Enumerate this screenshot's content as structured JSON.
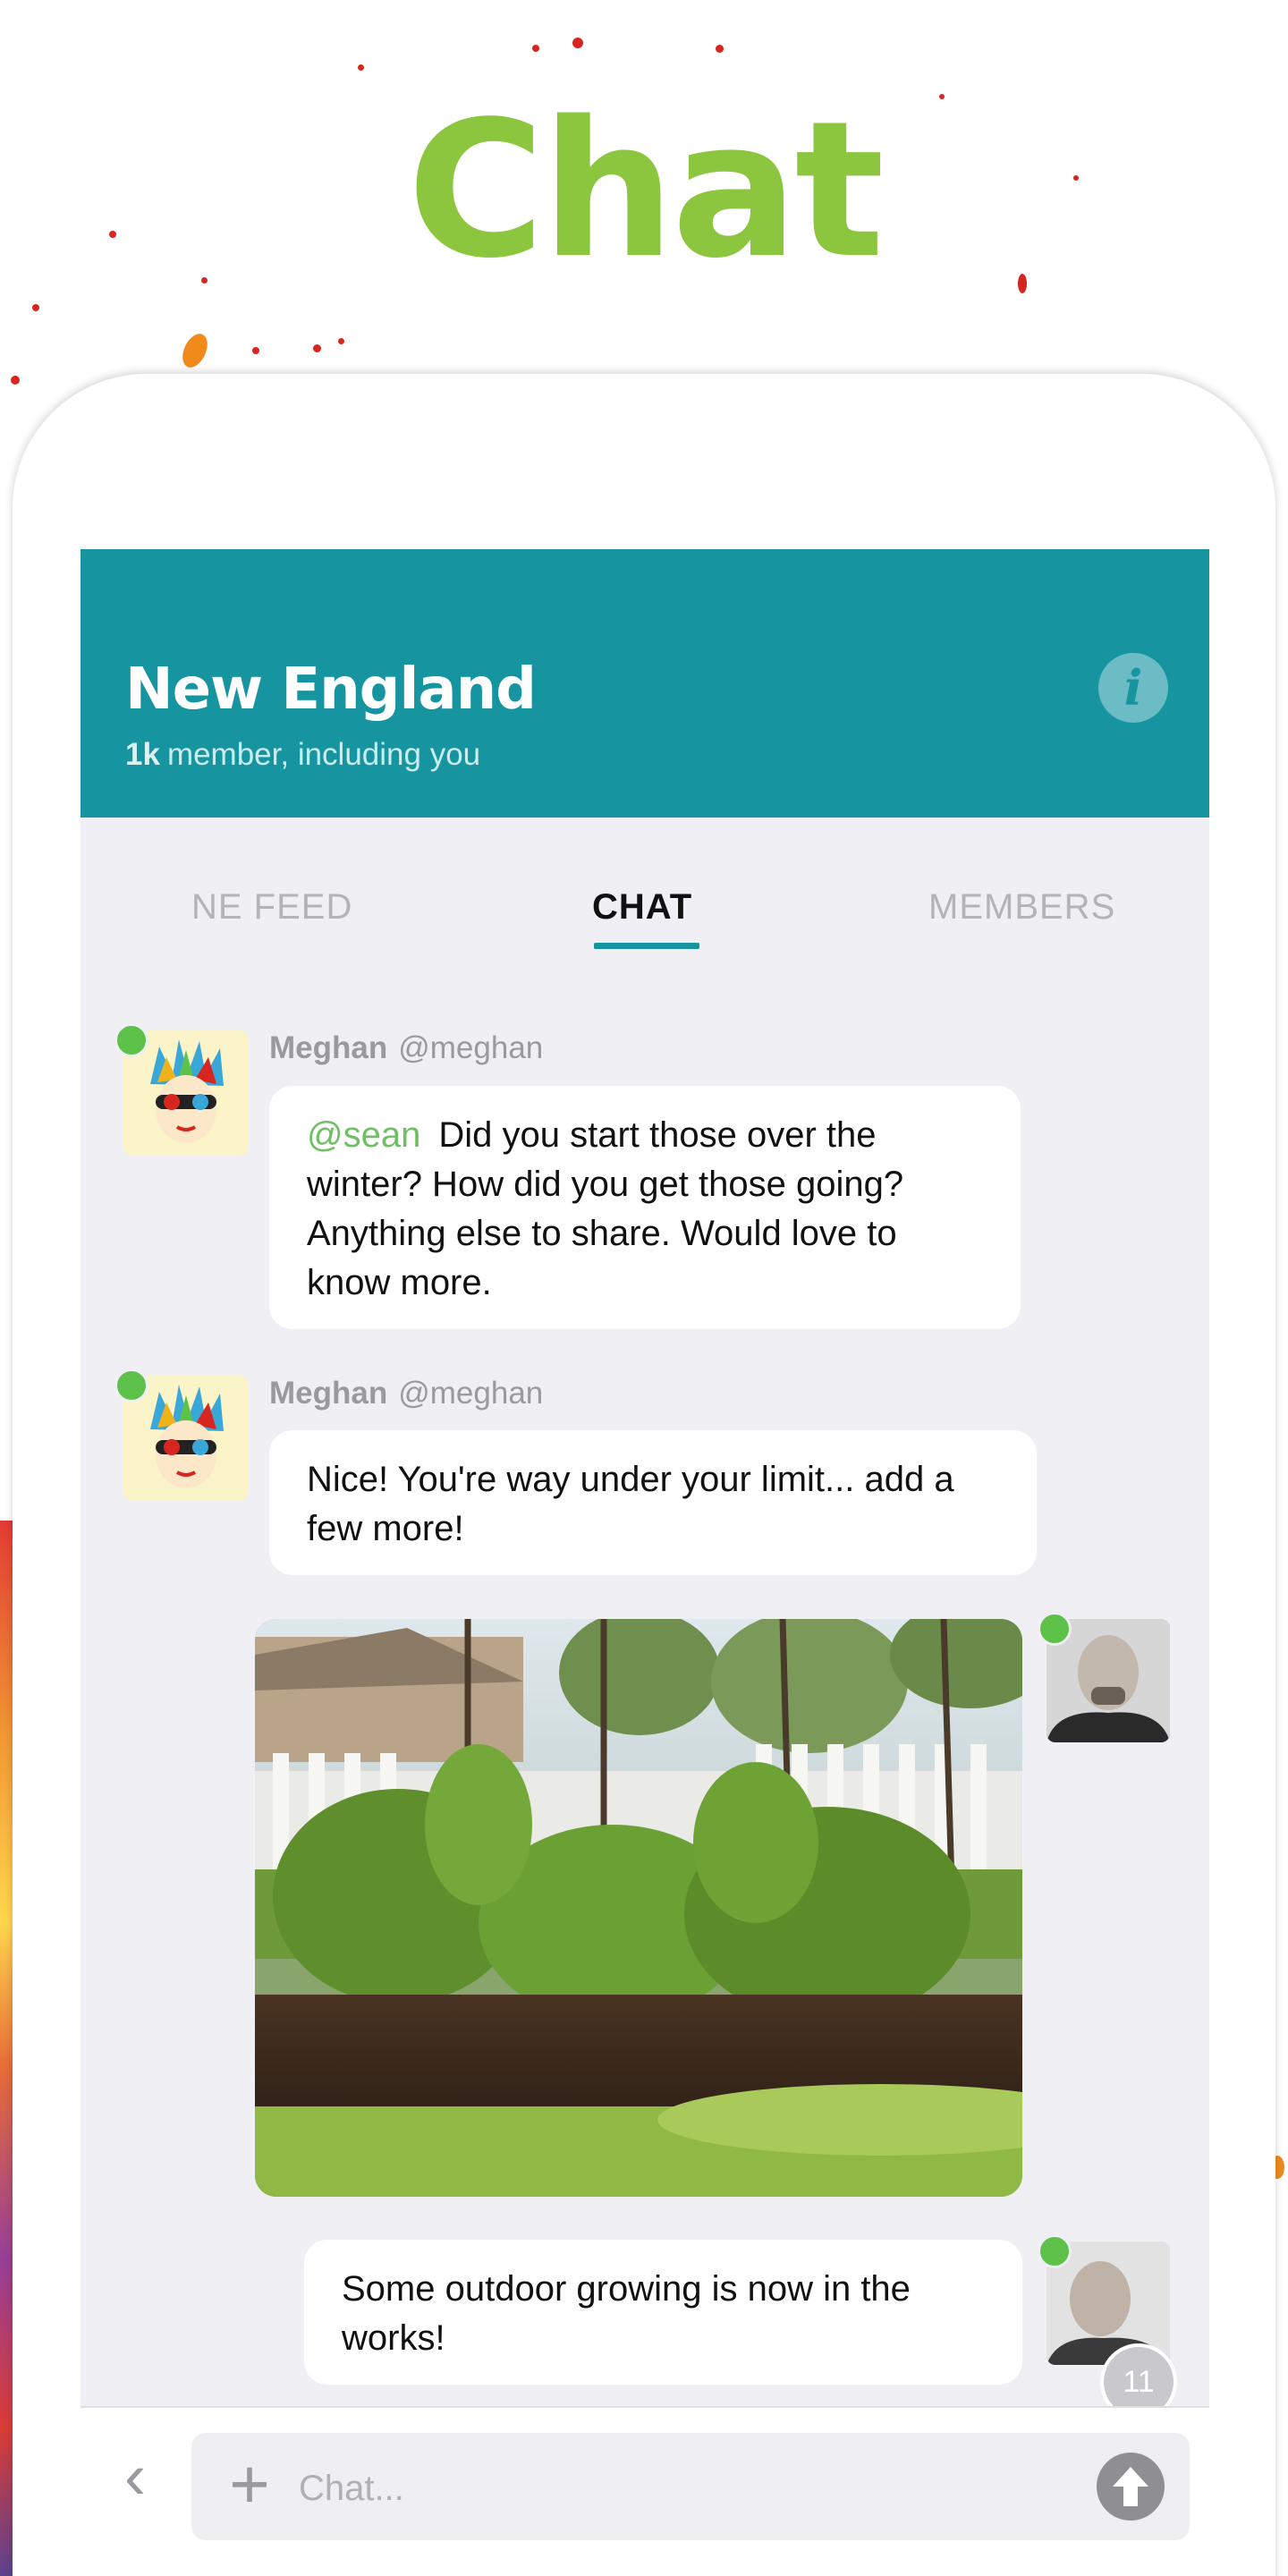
{
  "hero": {
    "title": "Chat"
  },
  "group": {
    "name": "New England",
    "member_count": "1k",
    "member_text": "member, including you",
    "info_icon": "i"
  },
  "tabs": [
    {
      "label": "NE FEED",
      "active": false
    },
    {
      "label": "CHAT",
      "active": true
    },
    {
      "label": "MEMBERS",
      "active": false
    }
  ],
  "messages": [
    {
      "sender_name": "Meghan",
      "sender_handle": "@meghan",
      "mention": "@sean",
      "text": "Did you start those over the winter? How did you get those going? Anything else to share. Would love to know more."
    },
    {
      "sender_name": "Meghan",
      "sender_handle": "@meghan",
      "text": "Nice! You're way under your limit... add a few more!"
    },
    {
      "type": "image",
      "alt_icon": "garden-photo"
    },
    {
      "text": "Some outdoor growing is now in the works!"
    }
  ],
  "unread_badge": "11",
  "composer": {
    "placeholder": "Chat...",
    "plus_icon": "+",
    "back_icon": "‹"
  },
  "colors": {
    "accent": "#1695a0",
    "brand_green": "#8cc63f",
    "online": "#5ec24a",
    "mention": "#6fbf63"
  }
}
